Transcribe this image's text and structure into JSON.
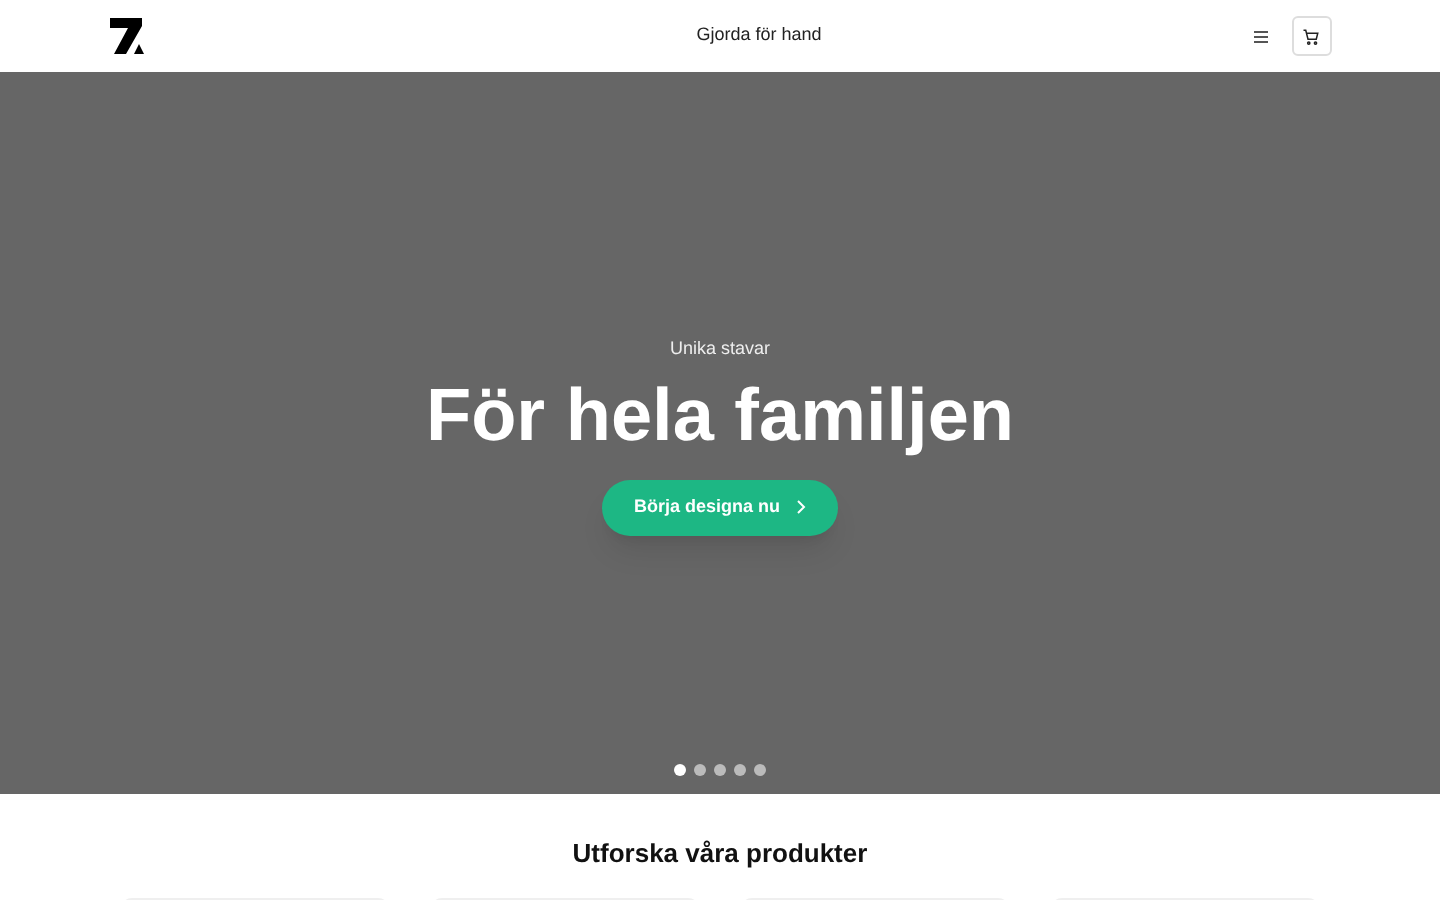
{
  "header": {
    "tagline": "Gjorda för hand"
  },
  "hero": {
    "eyebrow": "Unika stavar",
    "title": "För hela familjen",
    "button": "Börja designa nu",
    "slides": [
      {
        "selected": true
      },
      {
        "selected": false
      },
      {
        "selected": false
      },
      {
        "selected": false
      },
      {
        "selected": false
      }
    ]
  },
  "products": {
    "title": "Utforska våra produkter"
  }
}
